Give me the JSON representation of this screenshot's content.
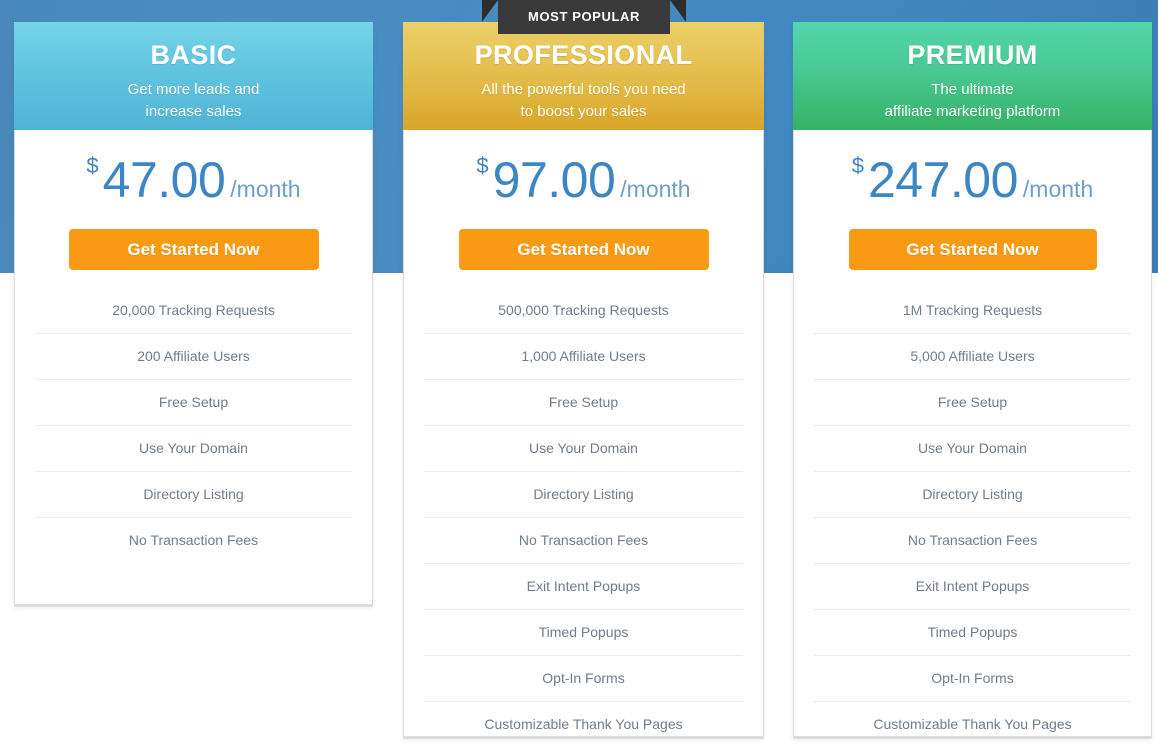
{
  "page": {
    "background_top_color": "#4488bf",
    "background_bottom_color": "#ffffff",
    "accent_cta_color": "#fa9a14",
    "price_color": "#3d86c6"
  },
  "ribbon": {
    "label": "MOST POPULAR",
    "background_color": "#3a3a3a",
    "text_color": "#ffffff"
  },
  "plans": [
    {
      "id": "basic",
      "name": "BASIC",
      "tagline_line1": "Get more leads and",
      "tagline_line2": "increase sales",
      "header_color_top": "#74d4e8",
      "header_color_bottom": "#50b3d6",
      "currency": "$",
      "amount": "47.00",
      "period": "/month",
      "cta_label": "Get Started Now",
      "features": [
        "20,000 Tracking Requests",
        "200 Affiliate Users",
        "Free Setup",
        "Use Your Domain",
        "Directory Listing",
        "No Transaction Fees"
      ]
    },
    {
      "id": "professional",
      "name": "PROFESSIONAL",
      "tagline_line1": "All the powerful tools you need",
      "tagline_line2": "to boost your sales",
      "header_color_top": "#ecd06a",
      "header_color_bottom": "#d8a528",
      "currency": "$",
      "amount": "97.00",
      "period": "/month",
      "cta_label": "Get Started Now",
      "badge": "MOST POPULAR",
      "features": [
        "500,000 Tracking Requests",
        "1,000 Affiliate Users",
        "Free Setup",
        "Use Your Domain",
        "Directory Listing",
        "No Transaction Fees",
        "Exit Intent Popups",
        "Timed Popups",
        "Opt-In Forms",
        "Customizable Thank You Pages"
      ]
    },
    {
      "id": "premium",
      "name": "PREMIUM",
      "tagline_line1": "The ultimate",
      "tagline_line2": "affiliate marketing platform",
      "header_color_top": "#54d6ab",
      "header_color_bottom": "#36b264",
      "currency": "$",
      "amount": "247.00",
      "period": "/month",
      "cta_label": "Get Started Now",
      "features": [
        "1M Tracking Requests",
        "5,000 Affiliate Users",
        "Free Setup",
        "Use Your Domain",
        "Directory Listing",
        "No Transaction Fees",
        "Exit Intent Popups",
        "Timed Popups",
        "Opt-In Forms",
        "Customizable Thank You Pages"
      ]
    }
  ]
}
